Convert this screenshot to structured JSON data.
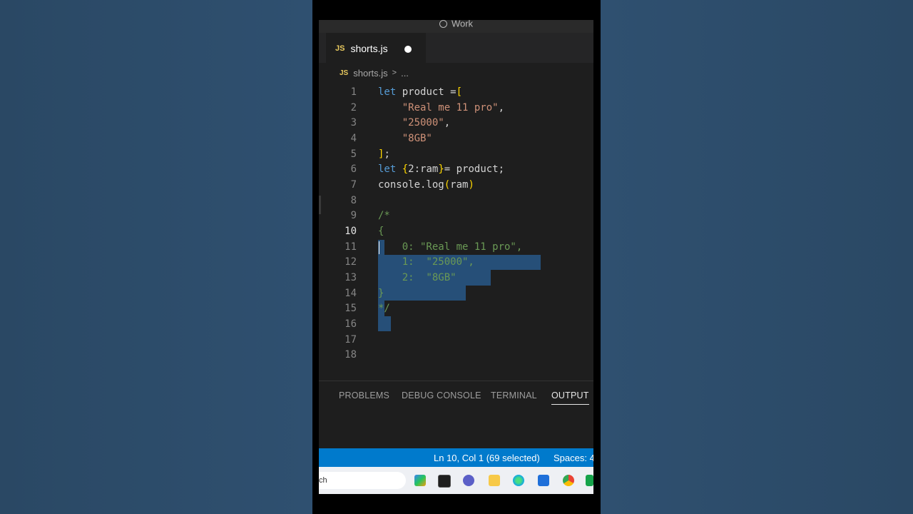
{
  "window": {
    "title": "Work"
  },
  "tab": {
    "badge": "JS",
    "title": "shorts.js",
    "unsaved": true
  },
  "breadcrumb": {
    "badge": "JS",
    "file": "shorts.js",
    "separator": ">",
    "more": "..."
  },
  "editor": {
    "active_line": 10,
    "line_numbers": [
      "1",
      "2",
      "3",
      "4",
      "5",
      "6",
      "7",
      "8",
      "9",
      "10",
      "11",
      "12",
      "13",
      "14",
      "15",
      "16",
      "17",
      "18"
    ],
    "lines": [
      "let product =[",
      "    \"Real me 11 pro\",",
      "    \"25000\",",
      "    \"8GB\"",
      "];",
      "let {2:ram}= product;",
      "console.log(ram)",
      "",
      "/*",
      "{",
      "    0: \"Real me 11 pro\",",
      "    1:  \"25000\",",
      "    2:  \"8GB\"",
      "}",
      "*/",
      "",
      "",
      ""
    ]
  },
  "panel": {
    "tabs": [
      "PROBLEMS",
      "DEBUG CONSOLE",
      "TERMINAL",
      "OUTPUT"
    ],
    "active_tab": "OUTPUT"
  },
  "statusbar": {
    "position": "Ln 10, Col 1 (69 selected)",
    "spaces": "Spaces: 4"
  },
  "taskbar": {
    "search_text": "ch",
    "apps": [
      "copilot-icon",
      "terminal-icon",
      "chat-icon",
      "file-explorer-icon",
      "browser-edge-icon",
      "vscode-icon",
      "chrome-icon",
      "app-icon"
    ]
  },
  "colors": {
    "editor_bg": "#1e1e1e",
    "statusbar_bg": "#007acc",
    "selection": "#264f78",
    "keyword": "#569cd6",
    "string": "#ce9178",
    "comment": "#6a9955"
  }
}
